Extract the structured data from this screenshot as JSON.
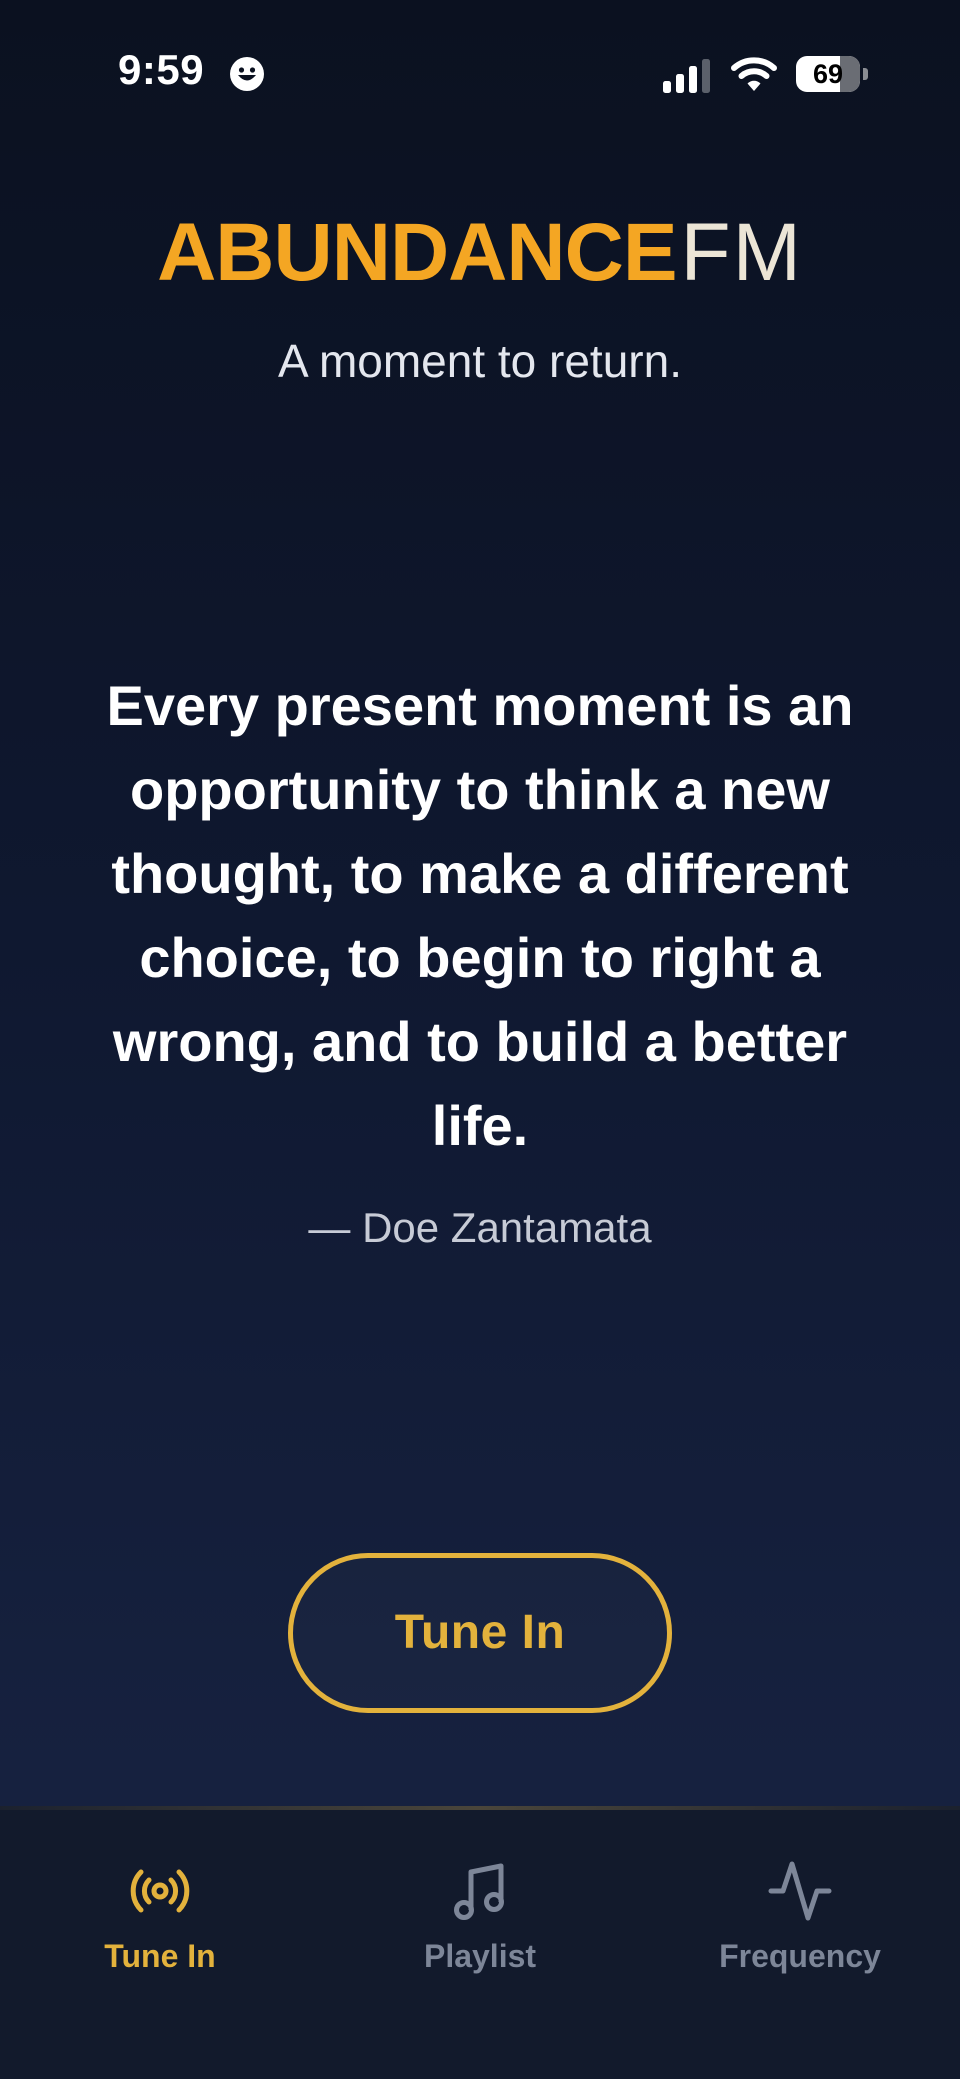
{
  "status_bar": {
    "time": "9:59",
    "battery_level": "69",
    "battery_fraction": 0.69
  },
  "header": {
    "brand_main": "ABUNDANCE",
    "brand_suffix": "FM",
    "tagline": "A moment to return."
  },
  "quote": {
    "text": "Every present moment is an opportunity to think a new thought, to make a different choice, to begin to right a wrong, and to build a better life.",
    "author": "— Doe Zantamata"
  },
  "primary_action": {
    "label": "Tune In"
  },
  "tab_bar": {
    "tabs": [
      {
        "label": "Tune In",
        "icon": "broadcast-icon",
        "active": true
      },
      {
        "label": "Playlist",
        "icon": "music-note-icon",
        "active": false
      },
      {
        "label": "Frequency",
        "icon": "activity-icon",
        "active": false
      }
    ]
  },
  "colors": {
    "accent": "#e3b23c",
    "brand_orange": "#f4a623",
    "inactive": "#7d8698",
    "background": "#0f1830"
  }
}
